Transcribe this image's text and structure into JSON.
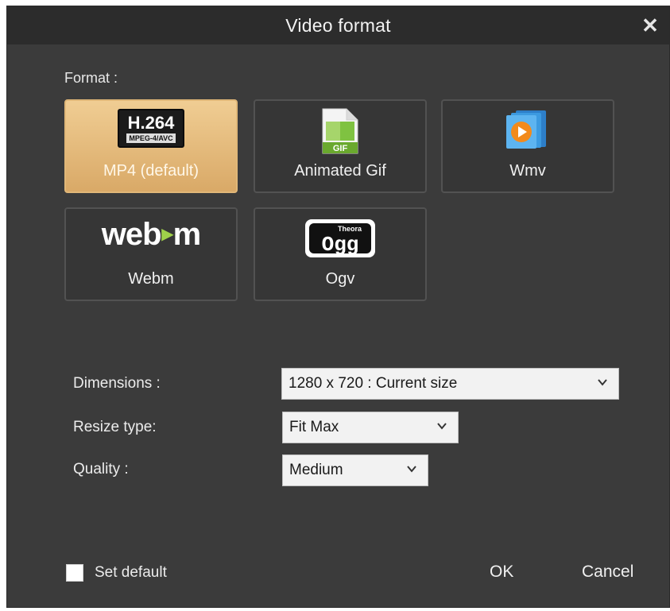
{
  "dialog": {
    "title": "Video format",
    "close_symbol": "✕"
  },
  "format_section": {
    "label": "Format :"
  },
  "formats": [
    {
      "id": "mp4",
      "label": "MP4 (default)",
      "icon": "h264-icon",
      "badge_top": "H.264",
      "badge_bottom": "MPEG-4/AVC",
      "selected": true
    },
    {
      "id": "gif",
      "label": "Animated Gif",
      "icon": "gif-file-icon",
      "badge": "GIF",
      "selected": false
    },
    {
      "id": "wmv",
      "label": "Wmv",
      "icon": "wmv-media-icon",
      "selected": false
    },
    {
      "id": "webm",
      "label": "Webm",
      "icon": "webm-logo-icon",
      "logo_left": "web",
      "logo_play": "▸",
      "logo_right": "m",
      "selected": false
    },
    {
      "id": "ogv",
      "label": "Ogv",
      "icon": "ogg-theora-icon",
      "logo_top": "Theora",
      "logo_main": "Ogg",
      "selected": false
    }
  ],
  "settings": {
    "dimensions": {
      "label": "Dimensions :",
      "value": "1280 x 720 : Current size"
    },
    "resize": {
      "label": "Resize type:",
      "value": "Fit Max"
    },
    "quality": {
      "label": "Quality :",
      "value": "Medium"
    }
  },
  "footer": {
    "set_default_label": "Set default",
    "set_default_checked": false,
    "ok_label": "OK",
    "cancel_label": "Cancel"
  },
  "colors": {
    "background": "#3b3b3b",
    "titlebar": "#2c2c2c",
    "selected_tile": "#e3b676",
    "tile_border": "#525252"
  }
}
